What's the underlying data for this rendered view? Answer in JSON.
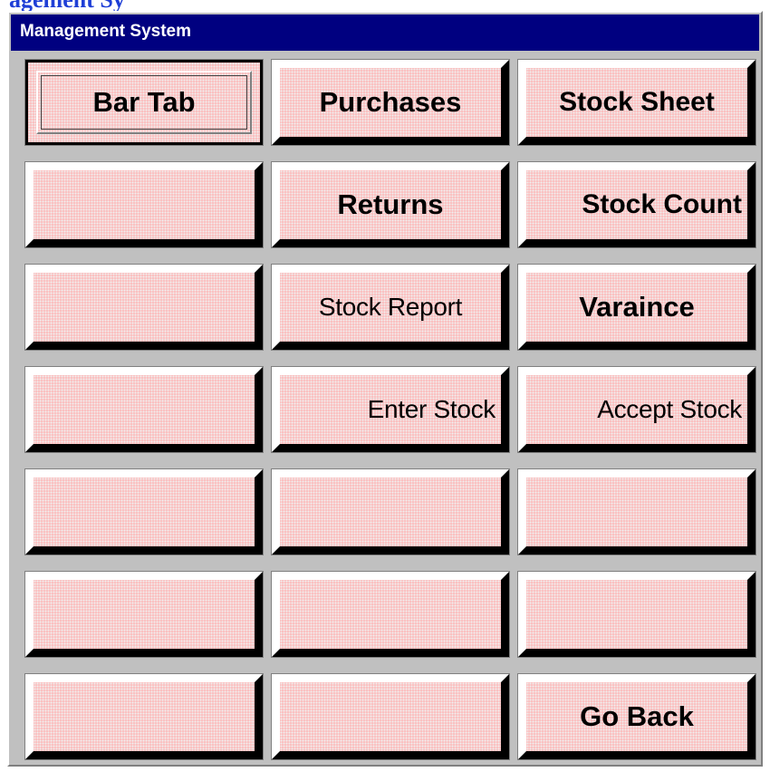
{
  "header": {
    "partial_text": "agement Sy"
  },
  "window": {
    "title": "Management System"
  },
  "buttons": [
    {
      "label": "Bar Tab"
    },
    {
      "label": "Purchases"
    },
    {
      "label": "Stock Sheet"
    },
    {
      "label": ""
    },
    {
      "label": "Returns"
    },
    {
      "label": "Stock Count"
    },
    {
      "label": ""
    },
    {
      "label": "Stock Report"
    },
    {
      "label": "Varaince"
    },
    {
      "label": ""
    },
    {
      "label": "Enter Stock"
    },
    {
      "label": "Accept Stock"
    },
    {
      "label": ""
    },
    {
      "label": ""
    },
    {
      "label": ""
    },
    {
      "label": ""
    },
    {
      "label": ""
    },
    {
      "label": ""
    },
    {
      "label": ""
    },
    {
      "label": ""
    },
    {
      "label": "Go Back"
    }
  ],
  "colors": {
    "title_bar": "#000080",
    "button_face": "#fbbdbd",
    "window_bg": "#c0c0c0",
    "header_text": "#1f3fd6"
  }
}
